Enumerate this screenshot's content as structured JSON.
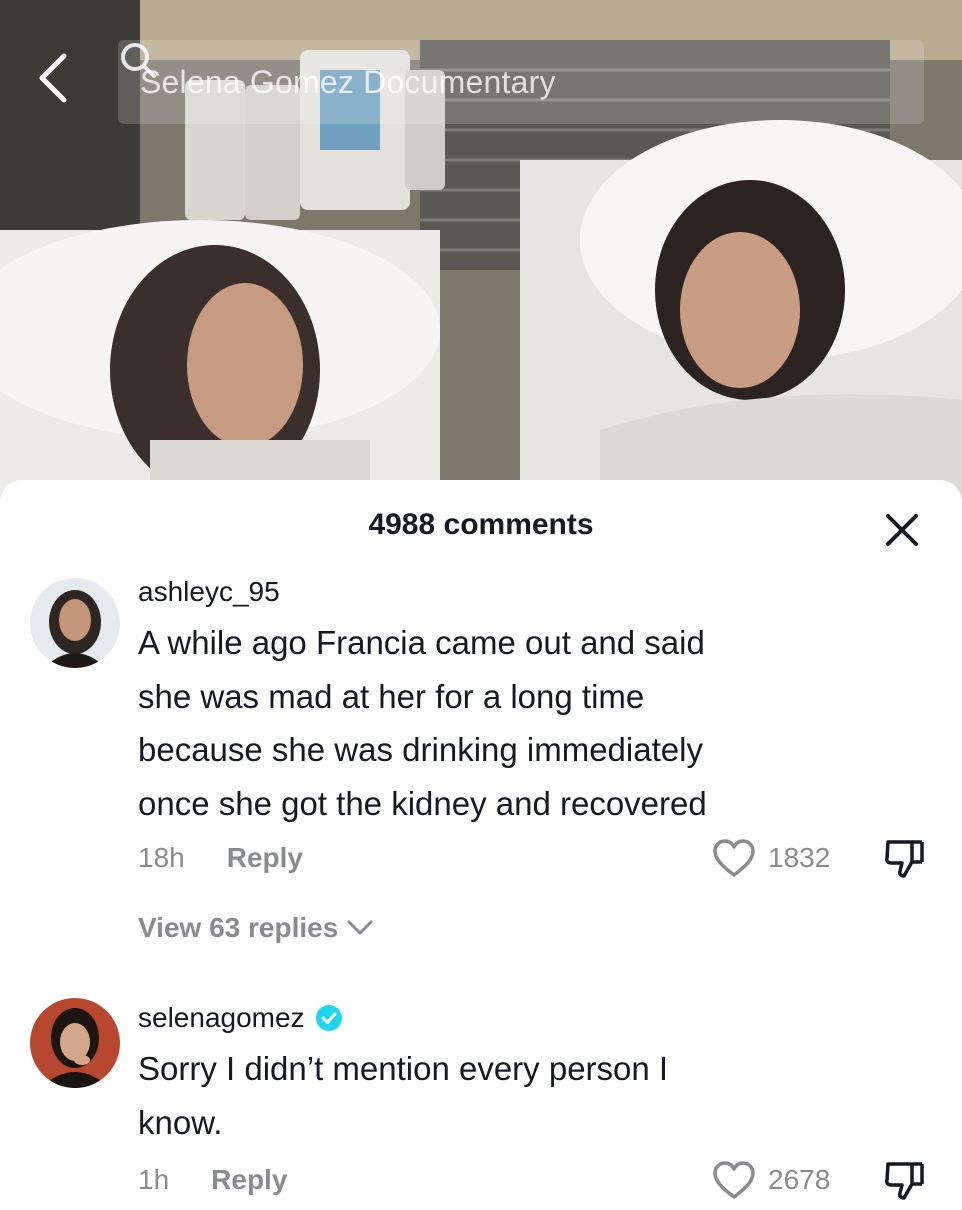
{
  "header": {
    "search_text": "Selena Gomez Documentary"
  },
  "sheet": {
    "comment_count_label": "4988 comments"
  },
  "comments": [
    {
      "username": "ashleyc_95",
      "verified": false,
      "text_lines": [
        "A while ago Francia came out and said",
        "she was mad at her for a long time",
        "because she was drinking immediately",
        "once she got the kidney and recovered"
      ],
      "time": "18h",
      "reply_label": "Reply",
      "likes": "1832",
      "view_replies_label": "View 63 replies"
    },
    {
      "username": "selenagomez",
      "verified": true,
      "text_lines": [
        "Sorry I didn’t mention every person I",
        "know."
      ],
      "time": "1h",
      "reply_label": "Reply",
      "likes": "2678"
    }
  ],
  "colors": {
    "text_primary": "#161823",
    "text_secondary": "#8a8b91",
    "verified_badge": "#20d5ec",
    "sheet_bg": "#ffffff"
  },
  "icons": {
    "back": "chevron-left-icon",
    "search": "search-icon",
    "close": "close-icon",
    "like": "heart-outline-icon",
    "dislike": "thumbs-down-icon",
    "verified": "verified-check-icon",
    "expand": "chevron-down-icon"
  }
}
